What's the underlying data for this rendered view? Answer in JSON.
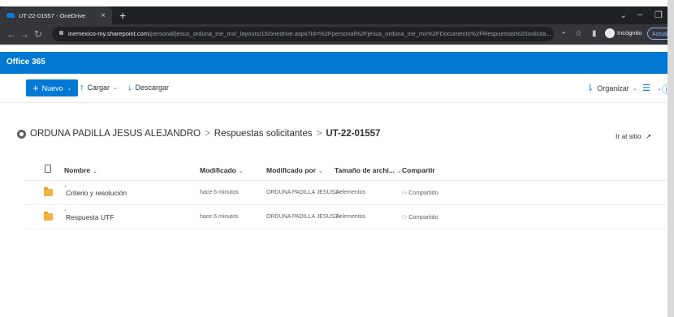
{
  "browser": {
    "tab_title": "UT-22-01557 - OneDrive",
    "tab_close": "×",
    "new_tab": "+",
    "minimize": "–",
    "restore": "❐",
    "chevron": "⌄",
    "url_host": "inemexico-my.sharepoint.com",
    "url_path": "/personal/jesus_orduna_ine_mx/_layouts/15/onedrive.aspx?id=%2Fpersonal%2Fjesus_orduna_ine_mx%2FDocuments%2FRespuestas%20solicita...",
    "profile_label": "Incógnito",
    "update_label": "Actualizar"
  },
  "suite": {
    "title": "Office 365"
  },
  "commands": {
    "new_label": "Nuevo",
    "upload_label": "Cargar",
    "download_label": "Descargar",
    "organize_label": "Organizar"
  },
  "breadcrumb": {
    "root": "ORDUNA PADILLA JESUS ALEJANDRO",
    "middle": "Respuestas solicitantes",
    "current": "UT-22-01557",
    "separator": ">",
    "go_to_site": "Ir al sitio"
  },
  "list": {
    "columns": [
      "Nombre",
      "Modificado",
      "Modificado por",
      "Tamaño de archi...",
      "Compartir"
    ],
    "rows": [
      {
        "name": "Criterio y resolución",
        "modified": "hace 6 minutos",
        "modified_by": "ORDUNA PADILLA JESUS A",
        "size": "2 elementos",
        "sharing": "Compartido"
      },
      {
        "name": "Respuesta UTF",
        "modified": "hace 6 minutos",
        "modified_by": "ORDUNA PADILLA JESUS A",
        "size": "3 elementos",
        "sharing": "Compartido"
      }
    ]
  },
  "colors": {
    "accent": "#0078d4",
    "folder": "#f3b43f",
    "chrome_dark": "#202124"
  }
}
